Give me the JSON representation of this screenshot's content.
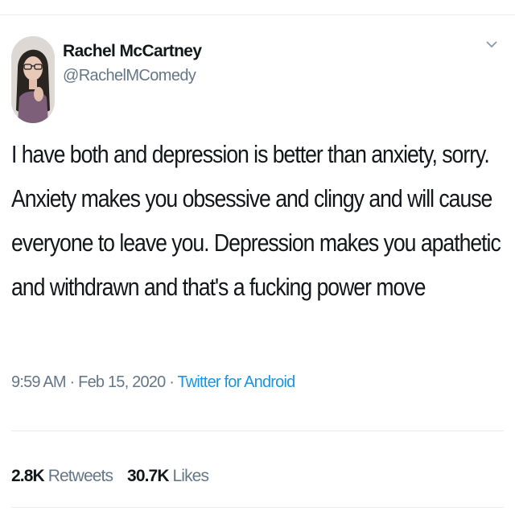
{
  "tweet": {
    "author": {
      "display_name": "Rachel McCartney",
      "handle": "@RachelMComedy",
      "avatar_icon": "profile-photo"
    },
    "menu_icon": "chevron-down-icon",
    "text_lines": [
      "I have both and depression is better than anxiety, sorry.",
      "Anxiety makes you obsessive and clingy and will cause",
      "everyone to leave you. Depression makes you apathetic",
      "and withdrawn and that's a fucking power move"
    ],
    "meta": {
      "time": "9:59 AM",
      "sep1": " · ",
      "date": "Feb 15, 2020",
      "sep2": " · ",
      "source": "Twitter for Android"
    },
    "stats": {
      "retweets_count": "2.8K",
      "retweets_label": "Retweets",
      "likes_count": "30.7K",
      "likes_label": "Likes"
    }
  },
  "colors": {
    "text": "#14171a",
    "muted": "#657786",
    "link": "#1b95e0",
    "divider": "#e6ecf0"
  }
}
